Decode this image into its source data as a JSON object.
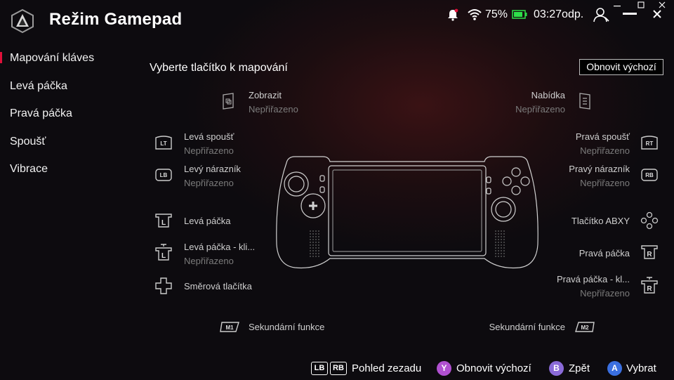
{
  "header": {
    "title": "Režim Gamepad",
    "battery": "75%",
    "time": "03:27odp.",
    "colors": {
      "accent": "#e0103a",
      "battery": "#2ee04a"
    }
  },
  "sidebar": {
    "items": [
      {
        "label": "Mapování kláves"
      },
      {
        "label": "Levá páčka"
      },
      {
        "label": "Pravá páčka"
      },
      {
        "label": "Spoušť"
      },
      {
        "label": "Vibrace"
      }
    ]
  },
  "main": {
    "heading": "Vyberte tlačítko k mapování",
    "reset_button": "Obnovit výchozí",
    "mappings": {
      "view": {
        "label": "Zobrazit",
        "value": "Nepřiřazeno",
        "icon": "view-icon"
      },
      "menu": {
        "label": "Nabídka",
        "value": "Nepřiřazeno",
        "icon": "menu-icon"
      },
      "lt": {
        "label": "Levá spoušť",
        "value": "Nepřiřazeno",
        "badge": "LT"
      },
      "rt": {
        "label": "Pravá spoušť",
        "value": "Nepřiřazeno",
        "badge": "RT"
      },
      "lb": {
        "label": "Levý nárazník",
        "value": "Nepřiřazeno",
        "badge": "LB"
      },
      "rb": {
        "label": "Pravý nárazník",
        "value": "Nepřiřazeno",
        "badge": "RB"
      },
      "ls": {
        "label": "Levá páčka",
        "badge": "L"
      },
      "abxy": {
        "label": "Tlačítko ABXY",
        "icon": "abxy-icon"
      },
      "ls_click": {
        "label": "Levá páčka - kli...",
        "value": "Nepřiřazeno",
        "badge": "L"
      },
      "rs": {
        "label": "Pravá páčka",
        "badge": "R"
      },
      "dpad": {
        "label": "Směrová tlačítka",
        "icon": "dpad-icon"
      },
      "rs_click": {
        "label": "Pravá páčka - kl...",
        "value": "Nepřiřazeno",
        "badge": "R"
      },
      "m1": {
        "label": "Sekundární funkce",
        "badge": "M1"
      },
      "m2": {
        "label": "Sekundární funkce",
        "badge": "M2"
      }
    }
  },
  "footer": {
    "lb": "LB",
    "rb": "RB",
    "rear_view": "Pohled zezadu",
    "y_glyph": "Y",
    "y_label": "Obnovit výchozí",
    "b_glyph": "B",
    "b_label": "Zpět",
    "a_glyph": "A",
    "a_label": "Vybrat",
    "colors": {
      "y": "#b050d0",
      "b": "#8a6ad8",
      "a": "#3a6fe0"
    }
  }
}
